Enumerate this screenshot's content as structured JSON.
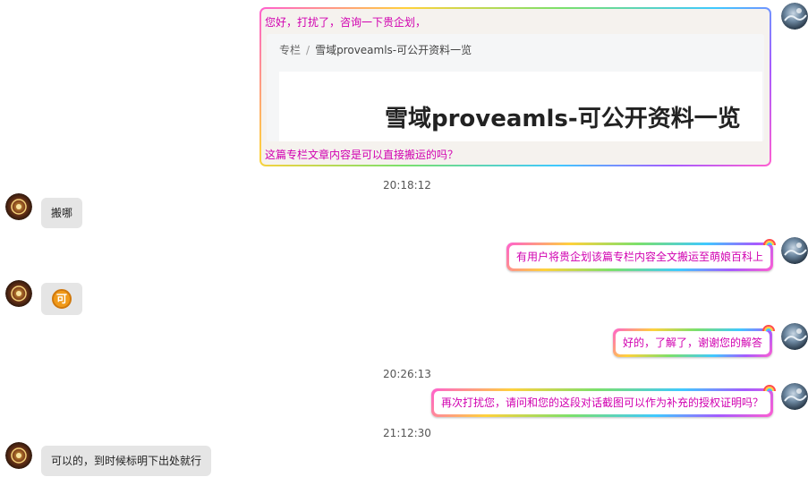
{
  "card": {
    "greeting": "您好，打扰了，咨询一下贵企划，",
    "breadcrumb_root": "专栏",
    "breadcrumb_sep": "/",
    "breadcrumb_current": "雪域proveamls-可公开资料一览",
    "article_title": "雪域proveamls-可公开资料一览",
    "question": "这篇专栏文章内容是可以直接搬运的吗？"
  },
  "timestamps": [
    "20:18:12",
    "20:26:13",
    "21:12:30"
  ],
  "messages": [
    {
      "side": "left",
      "text": "搬哪"
    },
    {
      "side": "right",
      "text": "有用户将贵企划该篇专栏内容全文搬运至萌娘百科上"
    },
    {
      "side": "left",
      "text": "",
      "sticker": "可"
    },
    {
      "side": "right",
      "text": "好的，了解了，谢谢您的解答"
    },
    {
      "side": "right",
      "text": "再次打扰您，请问和您的这段对话截图可以作为补充的授权证明吗？"
    },
    {
      "side": "left",
      "text": "可以的，到时候标明下出处就行"
    }
  ],
  "colors": {
    "outgoing_text": "#d100b0",
    "incoming_bubble": "#e5e5e5",
    "timestamp_text": "#555555",
    "sticker": "#f09a1a"
  },
  "icons": {
    "self_avatar": "self-avatar",
    "contact_avatar": "contact-avatar",
    "bubble_decoration": "rainbow-icon"
  }
}
